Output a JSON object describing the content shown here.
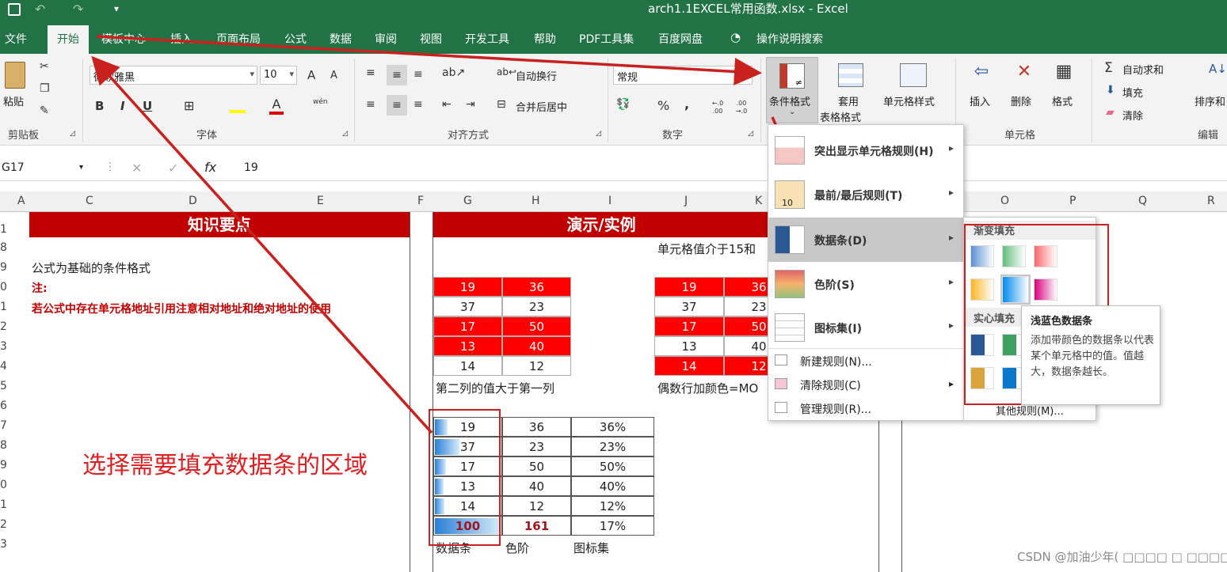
{
  "window": {
    "title": "arch1.1EXCEL常用函数.xlsx  -  Excel",
    "quick_access": "▾"
  },
  "tabs": [
    "文件",
    "开始",
    "模板中心",
    "插入",
    "页面布局",
    "公式",
    "数据",
    "审阅",
    "视图",
    "开发工具",
    "帮助",
    "PDF工具集",
    "百度网盘",
    "操作说明搜索"
  ],
  "ribbon": {
    "clipboard": {
      "paste": "粘贴",
      "group": "剪贴板"
    },
    "font": {
      "name": "微软雅黑",
      "size": "10",
      "group": "字体",
      "bold": "B",
      "italic": "I",
      "underline": "U",
      "grow": "A",
      "shrink": "A",
      "wen": "wén"
    },
    "align": {
      "wrap": "自动换行",
      "merge": "合并后居中",
      "group": "对齐方式"
    },
    "number": {
      "format": "常规",
      "percent": "%",
      "comma": ",",
      "group": "数字",
      "dec_up": "←.0 .00",
      "dec_down": ".00 →.0"
    },
    "styles": {
      "cond": "条件格式",
      "table_line1": "套用",
      "table_line2": "表格格式",
      "cell_style": "单元格样式"
    },
    "cells": {
      "insert": "插入",
      "delete": "删除",
      "format": "格式",
      "group": "单元格"
    },
    "edit": {
      "autosum": "自动求和",
      "fill": "填充",
      "clear": "清除",
      "sort": "排序和",
      "group": "编辑"
    }
  },
  "formula_bar": {
    "name_box": "G17",
    "fx": "fx",
    "value": "19",
    "cancel": "✕",
    "enter": "✓"
  },
  "columns": [
    "A",
    "C",
    "D",
    "E",
    "F",
    "G",
    "H",
    "I",
    "J",
    "K",
    "O",
    "P",
    "Q",
    "R"
  ],
  "rows": [
    "1",
    "8",
    "9",
    "0",
    "1",
    "2",
    "3",
    "4",
    "5",
    "6",
    "7",
    "8",
    "9",
    "0",
    "1",
    "2",
    "3"
  ],
  "sheet": {
    "left_header": "知识要点",
    "right_header": "演示/实例",
    "desc": "公式为基础的条件格式",
    "note_label": "注:",
    "note": "若公式中存在单元格地址引用注意相对地址和绝对地址的使用",
    "demo1_caption": "第二列的值大于第一列",
    "demo2_title": "单元格值介于15和",
    "demo2_caption": "偶数行加颜色=MO",
    "table1": [
      [
        "19",
        "36"
      ],
      [
        "37",
        "23"
      ],
      [
        "17",
        "50"
      ],
      [
        "13",
        "40"
      ],
      [
        "14",
        "12"
      ]
    ],
    "table2": [
      [
        "19",
        "36"
      ],
      [
        "37",
        "23"
      ],
      [
        "17",
        "50"
      ],
      [
        "13",
        "40"
      ],
      [
        "14",
        "12"
      ]
    ],
    "table3": [
      [
        "19",
        "36",
        "36%"
      ],
      [
        "37",
        "23",
        "23%"
      ],
      [
        "17",
        "50",
        "50%"
      ],
      [
        "13",
        "40",
        "40%"
      ],
      [
        "14",
        "12",
        "12%"
      ],
      [
        "100",
        "161",
        "17%"
      ]
    ],
    "databar_fractions": [
      0.19,
      0.37,
      0.17,
      0.13,
      0.14,
      1.0
    ],
    "table3_caps": [
      "数据条",
      "色阶",
      "图标集"
    ],
    "annotation": "选择需要填充数据条的区域"
  },
  "menu": {
    "items": [
      "突出显示单元格规则(H)",
      "最前/最后规则(T)",
      "数据条(D)",
      "色阶(S)",
      "图标集(I)"
    ],
    "small_items": [
      "新建规则(N)...",
      "清除规则(C)",
      "管理规则(R)..."
    ],
    "icon_labels": [
      "10"
    ]
  },
  "submenu": {
    "gradient": "渐变填充",
    "solid": "实心填充",
    "more": "其他规则(M)..."
  },
  "tooltip": {
    "title": "浅蓝色数据条",
    "body": "添加带颜色的数据条以代表某个单元格中的值。值越大，数据条越长。"
  },
  "watermark": "CSDN @加油少年( □□□□ □ □□□□ )",
  "colors": {
    "excel_green": "#217346",
    "header_red": "#c00000",
    "fill_red": "#ff0000",
    "annotation_red": "#c9211e"
  }
}
